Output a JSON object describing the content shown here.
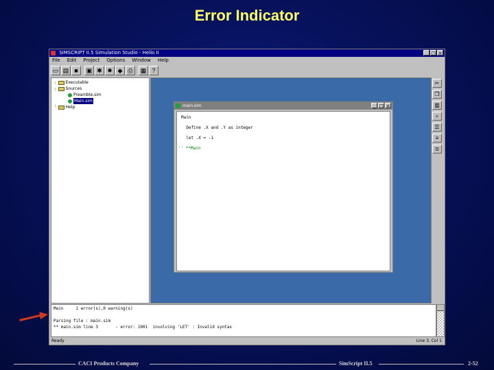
{
  "slide": {
    "title": "Error Indicator",
    "footer_left": "CACI Products Company",
    "footer_center": "SimScript II.5",
    "footer_right": "2-52"
  },
  "app": {
    "title": "SIMSCRIPT II.5 Simulation Studio - Hello II",
    "menus": [
      "File",
      "Edit",
      "Project",
      "Options",
      "Window",
      "Help"
    ],
    "tree": {
      "items": [
        {
          "label": "Executable",
          "type": "folder"
        },
        {
          "label": "Sources",
          "type": "folder"
        },
        {
          "label": "Preamble.sim",
          "type": "file"
        },
        {
          "label": "Main.sim",
          "type": "file",
          "selected": true
        },
        {
          "label": "Help",
          "type": "folder"
        }
      ]
    },
    "editor": {
      "title": "main.sim",
      "lines": [
        "Main",
        "  Define .X and .Y as integer",
        "  let .X = -1",
        "'' **Main"
      ]
    },
    "output": {
      "lines": [
        "Main     1 error(s),0 warning(s)",
        "",
        "Parsing file : main.sim",
        "** main.sim line 3       - error: 1001  involving 'LET' : Invalid syntax"
      ]
    },
    "status": {
      "left": "Ready",
      "right": "Line 3, Col 1"
    }
  },
  "colors": {
    "title": "#ffff66",
    "arrow": "#d23a1e",
    "mdi_bg": "#3a6aa8",
    "titlebar": "#000080"
  }
}
